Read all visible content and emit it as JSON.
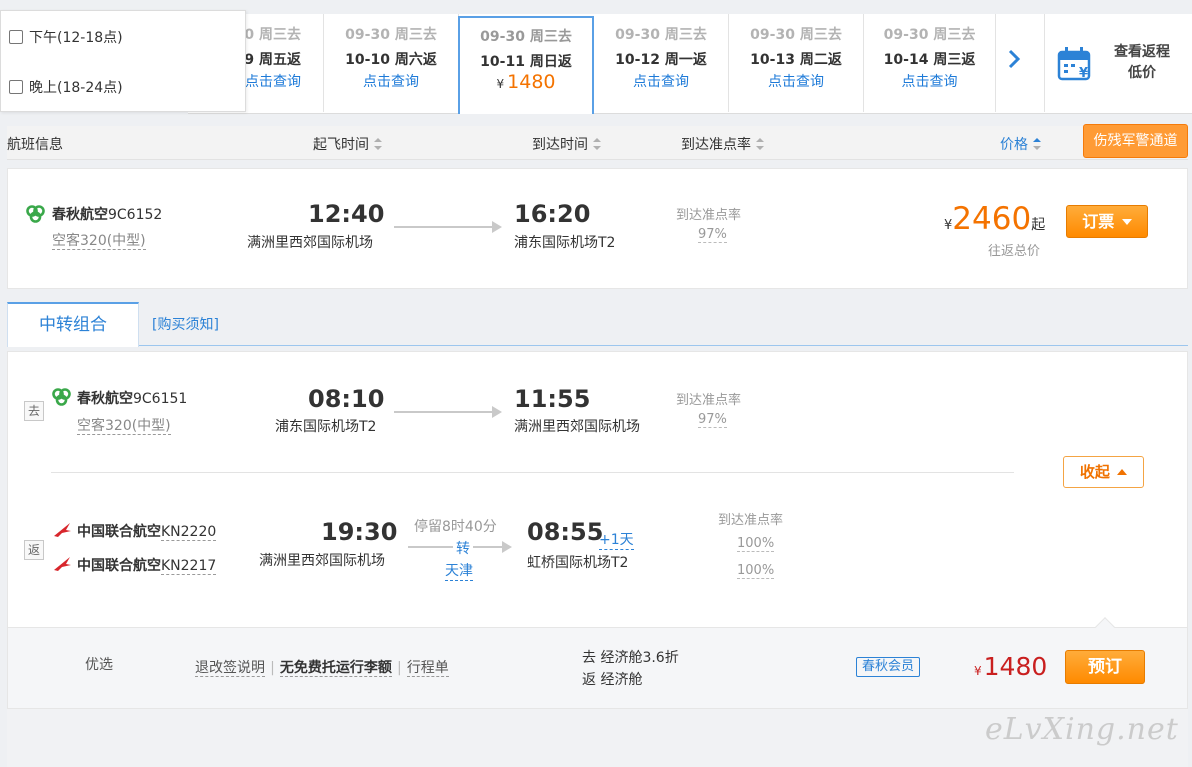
{
  "time_filter": {
    "options": [
      {
        "label": "下午(12-18点)",
        "checked": false
      },
      {
        "label": "晚上(18-24点)",
        "checked": false
      }
    ]
  },
  "date_bar": {
    "cells": [
      {
        "go": "0 周三去",
        "back": "9 周五返",
        "action": "点击查询"
      },
      {
        "go": "09-30 周三去",
        "back": "10-10 周六返",
        "action": "点击查询"
      },
      {
        "go": "09-30 周三去",
        "back": "10-11 周日返",
        "price_symbol": "¥",
        "price": "1480",
        "active": true
      },
      {
        "go": "09-30 周三去",
        "back": "10-12 周一返",
        "action": "点击查询"
      },
      {
        "go": "09-30 周三去",
        "back": "10-13 周二返",
        "action": "点击查询"
      },
      {
        "go": "09-30 周三去",
        "back": "10-14 周三返",
        "action": "点击查询"
      }
    ],
    "next_icon": "chevron-right-icon",
    "return_low_price": {
      "line1": "查看返程",
      "line2": "低价",
      "icon": "calendar-yen-icon"
    }
  },
  "list_header": {
    "flight_info": "航班信息",
    "depart_time": "起飞时间",
    "arrive_time": "到达时间",
    "ontime_rate": "到达准点率",
    "price": "价格",
    "veteran_channel": "伤残军警通道"
  },
  "flight": {
    "airline": "春秋航空",
    "flight_no": "9C6152",
    "aircraft": "空客320(中型)",
    "depart_time": "12:40",
    "depart_airport": "满洲里西郊国际机场",
    "arrive_time": "16:20",
    "arrive_airport": "浦东国际机场T2",
    "ontime_label": "到达准点率",
    "ontime_value": "97%",
    "price_symbol": "¥",
    "price": "2460",
    "price_suffix": "起",
    "price_note": "往返总价",
    "book_label": "订票"
  },
  "tabs": {
    "transfer": "中转组合",
    "notice": "[购买须知]"
  },
  "combo": {
    "outbound": {
      "tag": "去",
      "airline": "春秋航空",
      "flight_no": "9C6151",
      "aircraft": "空客320(中型)",
      "depart_time": "08:10",
      "depart_airport": "浦东国际机场T2",
      "arrive_time": "11:55",
      "arrive_airport": "满洲里西郊国际机场",
      "ontime_label": "到达准点率",
      "ontime_value": "97%"
    },
    "collapse_label": "收起",
    "return": {
      "tag": "返",
      "airline1": "中国联合航空",
      "flight_no1": "KN2220",
      "airline2": "中国联合航空",
      "flight_no2": "KN2217",
      "depart_time": "19:30",
      "depart_airport": "满洲里西郊国际机场",
      "stop_info": "停留8时40分",
      "transfer_char": "转",
      "transfer_city": "天津",
      "arrive_time": "08:55",
      "plus_day": "+1天",
      "arrive_airport": "虹桥国际机场T2",
      "ontime_label": "到达准点率",
      "ontime_value1": "100%",
      "ontime_value2": "100%"
    }
  },
  "fare": {
    "tag": "优选",
    "refund_rules": "退改签说明",
    "baggage": "无免费托运行李额",
    "itinerary": "行程单",
    "sep": "|",
    "cabin_go": "去 经济舱3.6折",
    "cabin_back": "返 经济舱",
    "member_badge": "春秋会员",
    "price_symbol": "¥",
    "price": "1480",
    "book_label": "预订"
  },
  "watermark": "eLvXing.net",
  "colors": {
    "accent_blue": "#2c82d6",
    "orange": "#ff8a00",
    "price_orange": "#f47300",
    "price_red": "#c91f1f",
    "spring_green": "#3aa84a",
    "united_red": "#d8262c"
  }
}
